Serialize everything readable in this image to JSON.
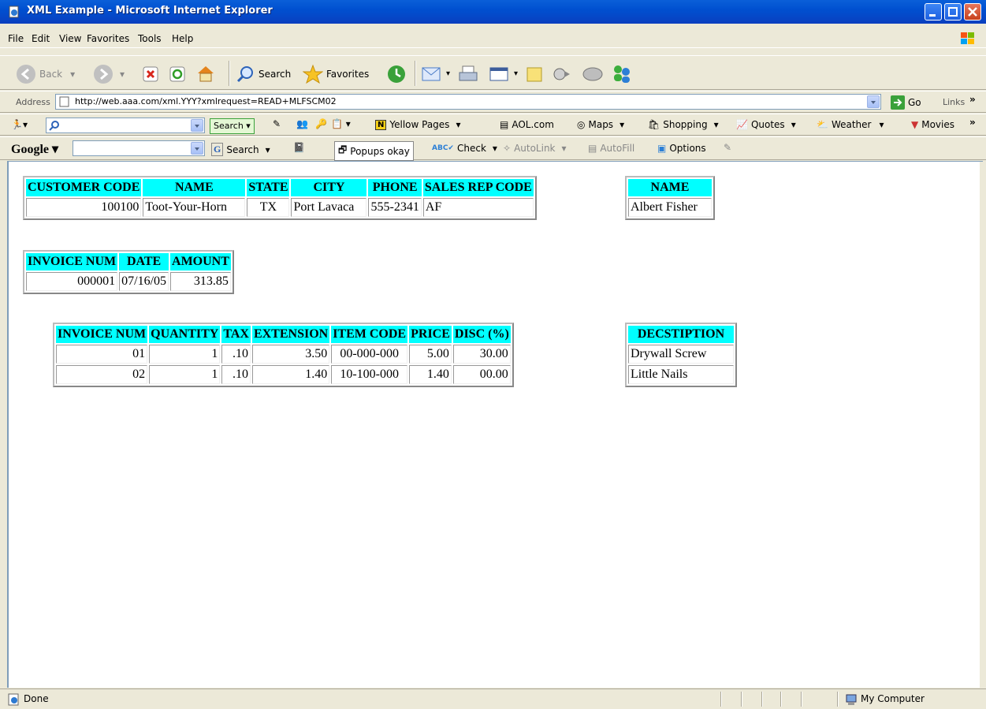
{
  "window": {
    "title": "XML Example - Microsoft Internet Explorer"
  },
  "menu": [
    "File",
    "Edit",
    "View",
    "Favorites",
    "Tools",
    "Help"
  ],
  "toolbar": {
    "back": "Back",
    "search": "Search",
    "favorites": "Favorites"
  },
  "address": {
    "label": "Address",
    "url": "http://web.aaa.com/xml.YYY?xmlrequest=READ+MLFSCM02",
    "go": "Go",
    "links": "Links"
  },
  "aolbar": {
    "search_btn": "Search",
    "yellow_pages": "Yellow Pages",
    "aol": "AOL.com",
    "maps": "Maps",
    "shopping": "Shopping",
    "quotes": "Quotes",
    "weather": "Weather",
    "movies": "Movies"
  },
  "googlebar": {
    "logo": "Google",
    "search": "Search",
    "popups": "Popups okay",
    "check": "Check",
    "autolink": "AutoLink",
    "autofill": "AutoFill",
    "options": "Options"
  },
  "customer": {
    "headers": [
      "CUSTOMER CODE",
      "NAME",
      "STATE",
      "CITY",
      "PHONE",
      "SALES REP CODE"
    ],
    "row": [
      "100100",
      "Toot-Your-Horn",
      "TX",
      "Port Lavaca",
      "555-2341",
      "AF"
    ]
  },
  "rep": {
    "header": "NAME",
    "value": "Albert Fisher"
  },
  "invoice": {
    "headers": [
      "INVOICE NUM",
      "DATE",
      "AMOUNT"
    ],
    "row": [
      "000001",
      "07/16/05",
      "313.85"
    ]
  },
  "items": {
    "headers": [
      "INVOICE NUM",
      "QUANTITY",
      "TAX",
      "EXTENSION",
      "ITEM CODE",
      "PRICE",
      "DISC (%)"
    ],
    "rows": [
      [
        "01",
        "1",
        ".10",
        "3.50",
        "00-000-000",
        "5.00",
        "30.00"
      ],
      [
        "02",
        "1",
        ".10",
        "1.40",
        "10-100-000",
        "1.40",
        "00.00"
      ]
    ]
  },
  "desc": {
    "header": "DECSTIPTION",
    "rows": [
      "Drywall Screw",
      "Little Nails"
    ]
  },
  "status": {
    "text": "Done",
    "zone": "My Computer"
  }
}
